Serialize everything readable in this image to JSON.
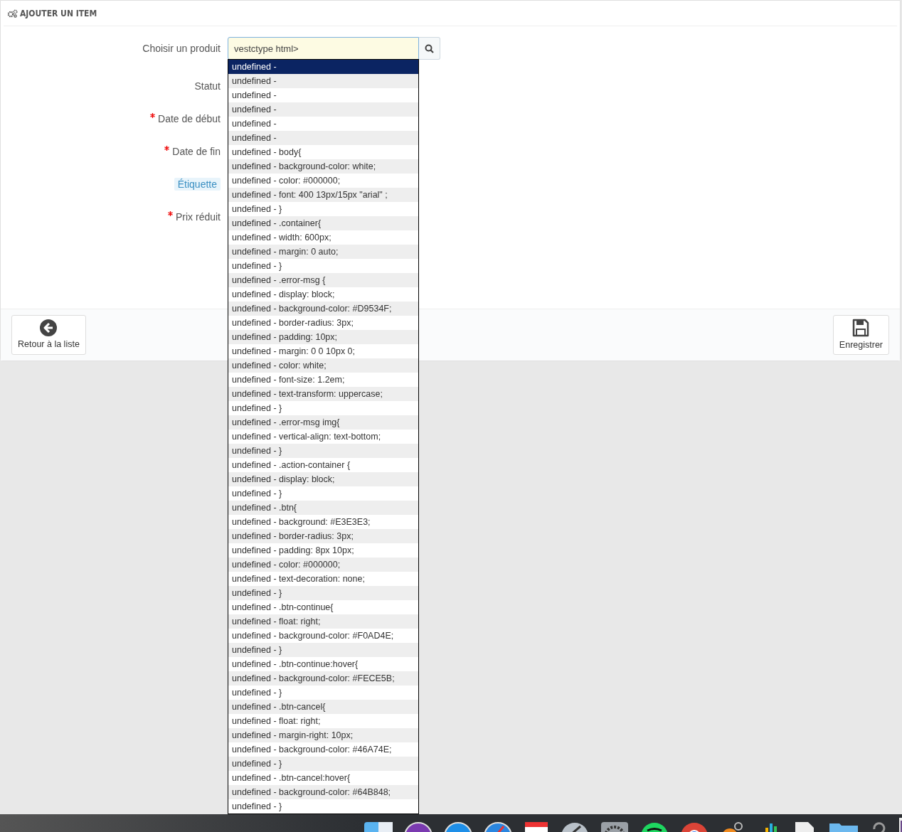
{
  "panel": {
    "title": "AJOUTER UN ITEM"
  },
  "form": {
    "fields": [
      {
        "label": "Choisir un produit",
        "required": false,
        "kind": "search"
      },
      {
        "label": "Statut",
        "required": false,
        "kind": "plain"
      },
      {
        "label": "Date de début",
        "required": true,
        "kind": "plain"
      },
      {
        "label": "Date de fin",
        "required": true,
        "kind": "plain"
      },
      {
        "label": "Étiquette",
        "required": false,
        "kind": "hint"
      },
      {
        "label": "Prix réduit",
        "required": true,
        "kind": "plain"
      }
    ],
    "search_value": "vestctype html>"
  },
  "suggestions": [
    {
      "text": "undefined -",
      "selected": true
    },
    {
      "text": "undefined -",
      "selected": false
    },
    {
      "text": "undefined -",
      "selected": false
    },
    {
      "text": "undefined -",
      "selected": false
    },
    {
      "text": "undefined -",
      "selected": false
    },
    {
      "text": "undefined -",
      "selected": false
    },
    {
      "text": "undefined - body{",
      "selected": false
    },
    {
      "text": "undefined - background-color: white;",
      "selected": false
    },
    {
      "text": "undefined - color: #000000;",
      "selected": false
    },
    {
      "text": "undefined - font: 400 13px/15px \"arial\" ;",
      "selected": false
    },
    {
      "text": "undefined - }",
      "selected": false
    },
    {
      "text": "undefined - .container{",
      "selected": false
    },
    {
      "text": "undefined - width: 600px;",
      "selected": false
    },
    {
      "text": "undefined - margin: 0 auto;",
      "selected": false
    },
    {
      "text": "undefined - }",
      "selected": false
    },
    {
      "text": "undefined - .error-msg {",
      "selected": false
    },
    {
      "text": "undefined - display: block;",
      "selected": false
    },
    {
      "text": "undefined - background-color: #D9534F;",
      "selected": false
    },
    {
      "text": "undefined - border-radius: 3px;",
      "selected": false
    },
    {
      "text": "undefined - padding: 10px;",
      "selected": false
    },
    {
      "text": "undefined - margin: 0 0 10px 0;",
      "selected": false
    },
    {
      "text": "undefined - color: white;",
      "selected": false
    },
    {
      "text": "undefined - font-size: 1.2em;",
      "selected": false
    },
    {
      "text": "undefined - text-transform: uppercase;",
      "selected": false
    },
    {
      "text": "undefined - }",
      "selected": false
    },
    {
      "text": "undefined - .error-msg img{",
      "selected": false
    },
    {
      "text": "undefined - vertical-align: text-bottom;",
      "selected": false
    },
    {
      "text": "undefined - }",
      "selected": false
    },
    {
      "text": "undefined - .action-container {",
      "selected": false
    },
    {
      "text": "undefined - display: block;",
      "selected": false
    },
    {
      "text": "undefined - }",
      "selected": false
    },
    {
      "text": "undefined - .btn{",
      "selected": false
    },
    {
      "text": "undefined - background: #E3E3E3;",
      "selected": false
    },
    {
      "text": "undefined - border-radius: 3px;",
      "selected": false
    },
    {
      "text": "undefined - padding: 8px 10px;",
      "selected": false
    },
    {
      "text": "undefined - color: #000000;",
      "selected": false
    },
    {
      "text": "undefined - text-decoration: none;",
      "selected": false
    },
    {
      "text": "undefined - }",
      "selected": false
    },
    {
      "text": "undefined - .btn-continue{",
      "selected": false
    },
    {
      "text": "undefined - float: right;",
      "selected": false
    },
    {
      "text": "undefined - background-color: #F0AD4E;",
      "selected": false
    },
    {
      "text": "undefined - }",
      "selected": false
    },
    {
      "text": "undefined - .btn-continue:hover{",
      "selected": false
    },
    {
      "text": "undefined - background-color: #FECE5B;",
      "selected": false
    },
    {
      "text": "undefined - }",
      "selected": false
    },
    {
      "text": "undefined - .btn-cancel{",
      "selected": false
    },
    {
      "text": "undefined - float: right;",
      "selected": false
    },
    {
      "text": "undefined - margin-right: 10px;",
      "selected": false
    },
    {
      "text": "undefined - background-color: #46A74E;",
      "selected": false
    },
    {
      "text": "undefined - }",
      "selected": false
    },
    {
      "text": "undefined - .btn-cancel:hover{",
      "selected": false
    },
    {
      "text": "undefined - background-color: #64B848;",
      "selected": false
    },
    {
      "text": "undefined - }",
      "selected": false
    }
  ],
  "footer": {
    "back_button": "Retour à la liste",
    "save_button": "Enregistrer"
  }
}
